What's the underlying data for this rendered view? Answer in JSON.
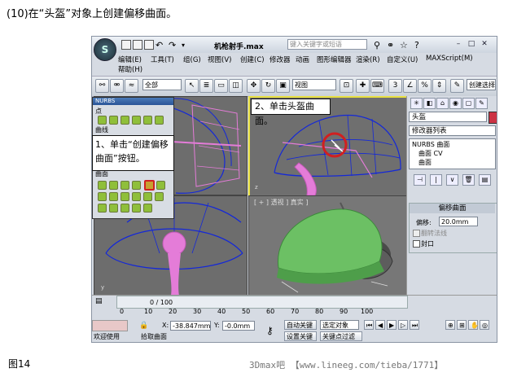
{
  "caption": "(10)在“头盔”对象上创建偏移曲面。",
  "figure_label": "图14",
  "watermark": "3Dmax吧 【www.lineeg.com/tieba/1771】",
  "window": {
    "title": "机枪射手.max",
    "search_placeholder": "键入关键字或短语",
    "menus": [
      "编辑(E)",
      "工具(T)",
      "组(G)",
      "视图(V)",
      "创建(C)",
      "修改器",
      "动画",
      "图形编辑器",
      "渲染(R)",
      "自定义(U)",
      "MAXScript(M)",
      "帮助(H)"
    ]
  },
  "toolbar": {
    "selection_filter": "全部",
    "coord_system": "视图",
    "named_selection": "创建选择"
  },
  "nurbs_panel": {
    "title": "NURBS",
    "section_point": "点",
    "section_curve": "曲线",
    "section_surface": "曲面"
  },
  "callouts": {
    "step1": "1、单击“创建偏移曲面”按钮。",
    "step2": "2、单击头盔曲面。"
  },
  "viewports": {
    "perspective_label": "[ + ] 透视 ] 真实 ]"
  },
  "command_panel": {
    "object_name": "头盔",
    "modifier_list": "修改器列表",
    "stack": [
      "NURBS 曲面",
      "曲面 CV",
      "曲面"
    ],
    "rollout_title": "偏移曲面",
    "offset_label": "偏移:",
    "offset_value": "20.0mm",
    "flip_normals": "翻转法线",
    "cap": "封口"
  },
  "status": {
    "frame_counter": "0 / 100",
    "ticks": [
      "0",
      "10",
      "20",
      "30",
      "40",
      "50",
      "60",
      "70",
      "80",
      "90",
      "100"
    ],
    "x_label": "X:",
    "x_value": "-38.847mm",
    "y_label": "Y:",
    "y_value": "-0.0mm",
    "auto_key": "自动关键点",
    "set_key": "设置关键点",
    "selected_object": "选定对象",
    "key_filter": "关键点过滤器...",
    "welcome": "欢迎使用",
    "prompt": "拾取曲面"
  },
  "colors": {
    "accent_yellow": "#e8e040",
    "helmet_green": "#6cc064",
    "nurbs_blue": "#1428d8",
    "pink": "#e47cd8",
    "callout_red": "#d02020"
  }
}
